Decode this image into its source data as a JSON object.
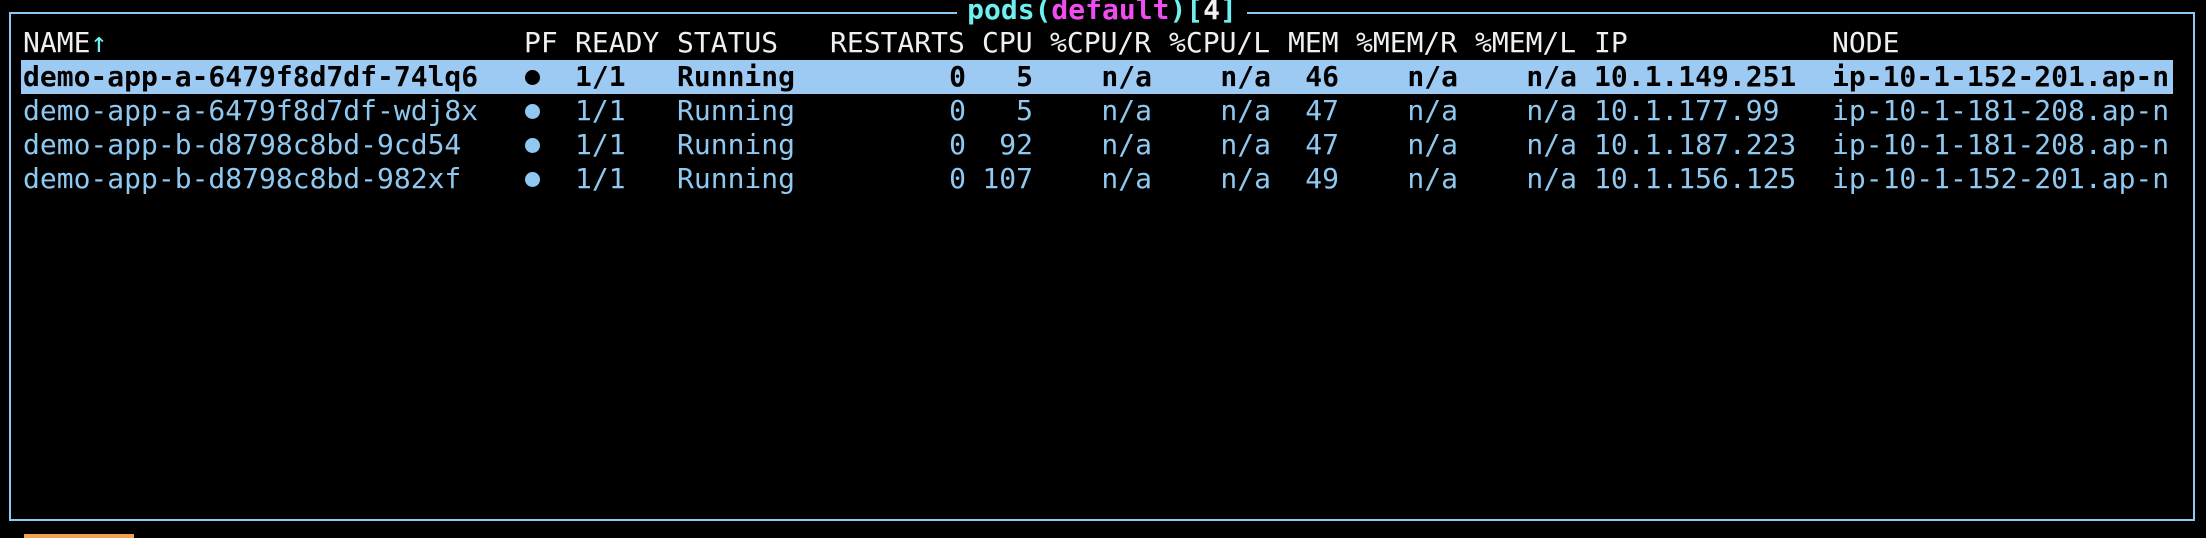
{
  "view": {
    "resource": "pods",
    "namespace": "default",
    "count": "4",
    "open_paren": "(",
    "close_paren": ")",
    "open_bracket": "[",
    "close_bracket": "]"
  },
  "columns": {
    "name": "NAME",
    "name_sort_indicator": "↑",
    "pf": "PF",
    "ready": "READY",
    "status": "STATUS",
    "restarts": "RESTARTS",
    "cpu": "CPU",
    "cpu_r": "%CPU/R",
    "cpu_l": "%CPU/L",
    "mem": "MEM",
    "mem_r": "%MEM/R",
    "mem_l": "%MEM/L",
    "ip": "IP",
    "node": "NODE"
  },
  "pods": [
    {
      "name": "demo-app-a-6479f8d7df-74lq6",
      "pf": "●",
      "ready": "1/1",
      "status": "Running",
      "restarts": "0",
      "cpu": "5",
      "cpu_r": "n/a",
      "cpu_l": "n/a",
      "mem": "46",
      "mem_r": "n/a",
      "mem_l": "n/a",
      "ip": "10.1.149.251",
      "node": "ip-10-1-152-201.ap-n"
    },
    {
      "name": "demo-app-a-6479f8d7df-wdj8x",
      "pf": "●",
      "ready": "1/1",
      "status": "Running",
      "restarts": "0",
      "cpu": "5",
      "cpu_r": "n/a",
      "cpu_l": "n/a",
      "mem": "47",
      "mem_r": "n/a",
      "mem_l": "n/a",
      "ip": "10.1.177.99",
      "node": "ip-10-1-181-208.ap-n"
    },
    {
      "name": "demo-app-b-d8798c8bd-9cd54",
      "pf": "●",
      "ready": "1/1",
      "status": "Running",
      "restarts": "0",
      "cpu": "92",
      "cpu_r": "n/a",
      "cpu_l": "n/a",
      "mem": "47",
      "mem_r": "n/a",
      "mem_l": "n/a",
      "ip": "10.1.187.223",
      "node": "ip-10-1-181-208.ap-n"
    },
    {
      "name": "demo-app-b-d8798c8bd-982xf",
      "pf": "●",
      "ready": "1/1",
      "status": "Running",
      "restarts": "0",
      "cpu": "107",
      "cpu_r": "n/a",
      "cpu_l": "n/a",
      "mem": "49",
      "mem_r": "n/a",
      "mem_l": "n/a",
      "ip": "10.1.156.125",
      "node": "ip-10-1-152-201.ap-n"
    }
  ],
  "selected_index": 0,
  "colors": {
    "background": "#000000",
    "foreground": "#8fc8f0",
    "header": "#f0f0f0",
    "selection_background": "#9ccaf2",
    "selection_foreground": "#000000",
    "resource_title": "#6ff0f0",
    "namespace_title": "#f04df0",
    "bottom_indicator": "#f0a050"
  }
}
